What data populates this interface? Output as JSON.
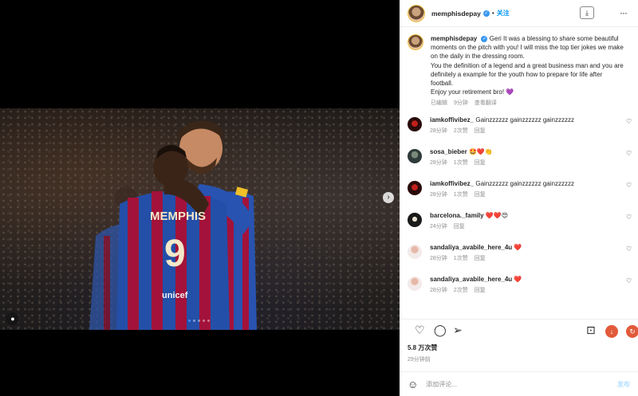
{
  "post": {
    "username": "memphisdepay",
    "follow_label": "关注",
    "separator": "•",
    "caption_user": "memphisdepay",
    "caption_text": "Geri It was a blessing to share some beautiful moments on the pitch with you! I will miss the top tier jokes we make on the daily in the dressing room.\nYou the definition of a legend and a great business man and you are definitely a example for the youth how to prepare for life after football.\nEnjoy your retirement bro! 💜",
    "caption_edited": "已编辑",
    "caption_time": "9分钟",
    "see_translation": "查看翻译",
    "jersey_name": "MEMPHIS",
    "jersey_number": "9",
    "sponsor": "unicef"
  },
  "comments": [
    {
      "user": "iamkoffivibez_",
      "text": "Gainzzzzzz gainzzzzzz gainzzzzzz",
      "time": "28分钟",
      "likes": "2次赞",
      "reply": "回复"
    },
    {
      "user": "sosa_bieber",
      "text": "🤩❤️👏",
      "time": "28分钟",
      "likes": "1次赞",
      "reply": "回复"
    },
    {
      "user": "iamkoffivibez_",
      "text": "Gainzzzzzz gainzzzzzz gainzzzzzz",
      "time": "28分钟",
      "likes": "1次赞",
      "reply": "回复"
    },
    {
      "user": "barcelona._family",
      "text": "❤️❤️😍",
      "time": "24分钟",
      "likes": "",
      "reply": "回复"
    },
    {
      "user": "sandaliya_avabile_here_4u",
      "text": "❤️",
      "time": "28分钟",
      "likes": "1次赞",
      "reply": "回复"
    },
    {
      "user": "sandaliya_avabile_here_4u",
      "text": "❤️",
      "time": "28分钟",
      "likes": "2次赞",
      "reply": "回复"
    }
  ],
  "footer": {
    "likes_count": "5.8 万次赞",
    "posted_time": "29分钟前",
    "comment_placeholder": "添加评论...",
    "post_label": "发布"
  },
  "icons": {
    "save": "download-icon",
    "more": "ellipsis-icon",
    "like": "heart-icon",
    "comment": "comment-icon",
    "share": "paper-plane-icon",
    "bookmark": "bookmark-icon",
    "emoji": "emoji-icon",
    "next": "chevron-right-icon",
    "tags": "user-tag-icon"
  },
  "colors": {
    "accent": "#0095f6",
    "verified": "#3897f0",
    "carousel_active": "#3d8bff",
    "jersey_blue": "#1f4fa8",
    "jersey_red": "#a3123a"
  },
  "carousel": {
    "slides": 5,
    "active": 1
  }
}
